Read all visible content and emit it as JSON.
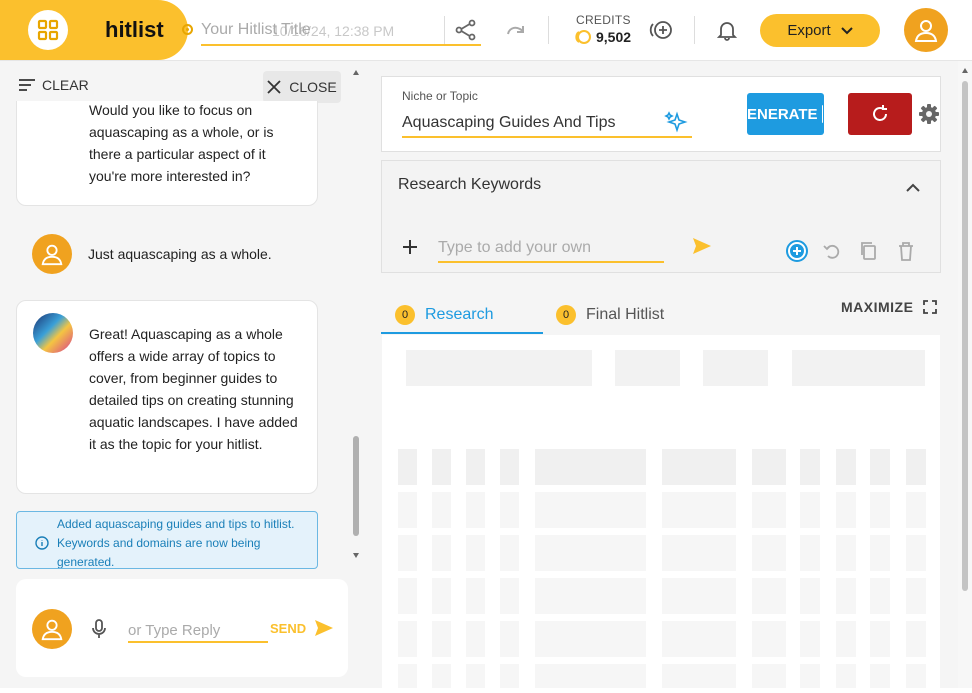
{
  "header": {
    "logo_text": "hitlist",
    "title_placeholder": "Your Hitlist Title",
    "title_date": "10/16/24, 12:38 PM",
    "credits_label": "CREDITS",
    "credits_value": "9,502",
    "export_label": "Export"
  },
  "left_panel": {
    "clear_label": "CLEAR",
    "close_label": "CLOSE",
    "messages": [
      {
        "role": "ai",
        "text": "Would you like to focus on aquascaping as a whole, or is there a particular aspect of it you're more interested in?"
      },
      {
        "role": "user",
        "text": "Just aquascaping as a whole."
      },
      {
        "role": "ai",
        "text": "Great! Aquascaping as a whole offers a wide array of topics to cover, from beginner guides to detailed tips on creating stunning aquatic landscapes. I have added it as the topic for your hitlist."
      }
    ],
    "notice_text": "Added aquascaping guides and tips to hitlist. Keywords and domains are now being generated.",
    "reply_placeholder": "or Type Reply",
    "send_label": "SEND"
  },
  "right_panel": {
    "niche_label": "Niche or Topic",
    "niche_value": "Aquascaping Guides And Tips",
    "generate_label": "ENERATE",
    "research_keywords_title": "Research Keywords",
    "keyword_placeholder": "Type to add your own",
    "tabs": [
      {
        "label": "Research",
        "count": "0"
      },
      {
        "label": "Final Hitlist",
        "count": "0"
      }
    ],
    "maximize_label": "MAXIMIZE"
  },
  "colors": {
    "brand_yellow": "#fbc02d",
    "accent_blue": "#1e9be0",
    "reset_red": "#b71c1c",
    "notice_bg": "#e4f2fb"
  }
}
